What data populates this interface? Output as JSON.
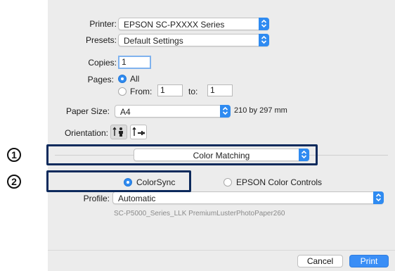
{
  "printer": {
    "label": "Printer:",
    "value": "EPSON SC-PXXXX Series"
  },
  "presets": {
    "label": "Presets:",
    "value": "Default Settings"
  },
  "copies": {
    "label": "Copies:",
    "value": "1"
  },
  "pages": {
    "label": "Pages:",
    "all_label": "All",
    "from_label": "From:",
    "from_value": "1",
    "to_label": "to:",
    "to_value": "1"
  },
  "paper_size": {
    "label": "Paper Size:",
    "value": "A4",
    "dimensions": "210 by 297 mm"
  },
  "orientation": {
    "label": "Orientation:"
  },
  "section_popup": {
    "value": "Color Matching"
  },
  "color_mode": {
    "option1": "ColorSync",
    "option2": "EPSON Color Controls"
  },
  "profile": {
    "label": "Profile:",
    "value": "Automatic",
    "description": "SC-P5000_Series_LLK PremiumLusterPhotoPaper260"
  },
  "buttons": {
    "cancel": "Cancel",
    "print": "Print"
  },
  "callouts": {
    "one": "1",
    "two": "2"
  },
  "colors": {
    "accent": "#2f8bf1",
    "callout_border": "#0d2a5c"
  }
}
